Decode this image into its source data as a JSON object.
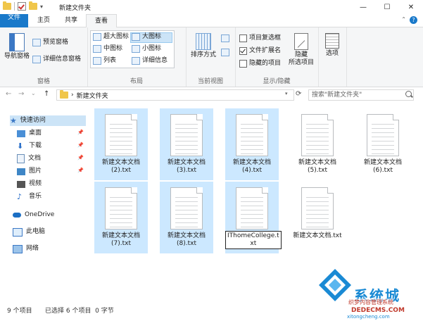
{
  "title_bar": {
    "title": "新建文件夹",
    "minimize": "—",
    "maximize": "☐",
    "close": "✕",
    "qa_dropdown": "▾"
  },
  "tabs": {
    "file": "文件",
    "home": "主页",
    "share": "共享",
    "view": "查看",
    "expand": "⌃",
    "help": "?"
  },
  "ribbon": {
    "pane": {
      "nav_pane": "导航窗格",
      "preview_pane": "预览窗格",
      "details_pane": "详细信息窗格",
      "label": "窗格"
    },
    "layout": {
      "extra_large": "超大图标",
      "large": "大图标",
      "medium": "中图标",
      "small": "小图标",
      "list": "列表",
      "details": "详细信息",
      "label": "布局"
    },
    "current_view": {
      "sort_by": "排序方式",
      "label": "当前视图"
    },
    "show_hide": {
      "item_checkboxes": "项目复选框",
      "file_extensions": "文件扩展名",
      "hidden_items": "隐藏的项目",
      "hide_selected_1": "隐藏",
      "hide_selected_2": "所选项目",
      "label": "显示/隐藏"
    },
    "options": {
      "label": "选项"
    }
  },
  "address": {
    "back": "←",
    "forward": "→",
    "recent": "⌄",
    "up": "↑",
    "path": "新建文件夹",
    "sep": "›",
    "search_placeholder": "搜索\"新建文件夹\"",
    "refresh": "⟳",
    "dropdown": "▾"
  },
  "nav": {
    "quick_access": "快速访问",
    "desktop": "桌面",
    "downloads": "下载",
    "documents": "文档",
    "pictures": "图片",
    "videos": "视频",
    "music": "音乐",
    "onedrive": "OneDrive",
    "this_pc": "此电脑",
    "network": "网络"
  },
  "files": [
    {
      "line1": "新建文本文档",
      "line2": "(2).txt"
    },
    {
      "line1": "新建文本文档",
      "line2": "(3).txt"
    },
    {
      "line1": "新建文本文档",
      "line2": "(4).txt"
    },
    {
      "line1": "新建文本文档",
      "line2": "(5).txt"
    },
    {
      "line1": "新建文本文档",
      "line2": "(6).txt"
    },
    {
      "line1": "新建文本文档",
      "line2": "(7).txt"
    },
    {
      "line1": "新建文本文档",
      "line2": "(8).txt"
    },
    {
      "line1": "IThomeCollege.t",
      "line2": "xt"
    },
    {
      "line1": "新建文本文档.txt",
      "line2": ""
    }
  ],
  "status": {
    "count": "9 个项目",
    "selected": "已选择 6 个项目  0 字节"
  },
  "watermark": {
    "name": "系统城",
    "sub": "织梦内容管理系统",
    "url": "DEDECMS.COM",
    "domain": "xitongcheng.com"
  },
  "colors": {
    "accent": "#1979ca",
    "selection": "#cce8ff"
  }
}
